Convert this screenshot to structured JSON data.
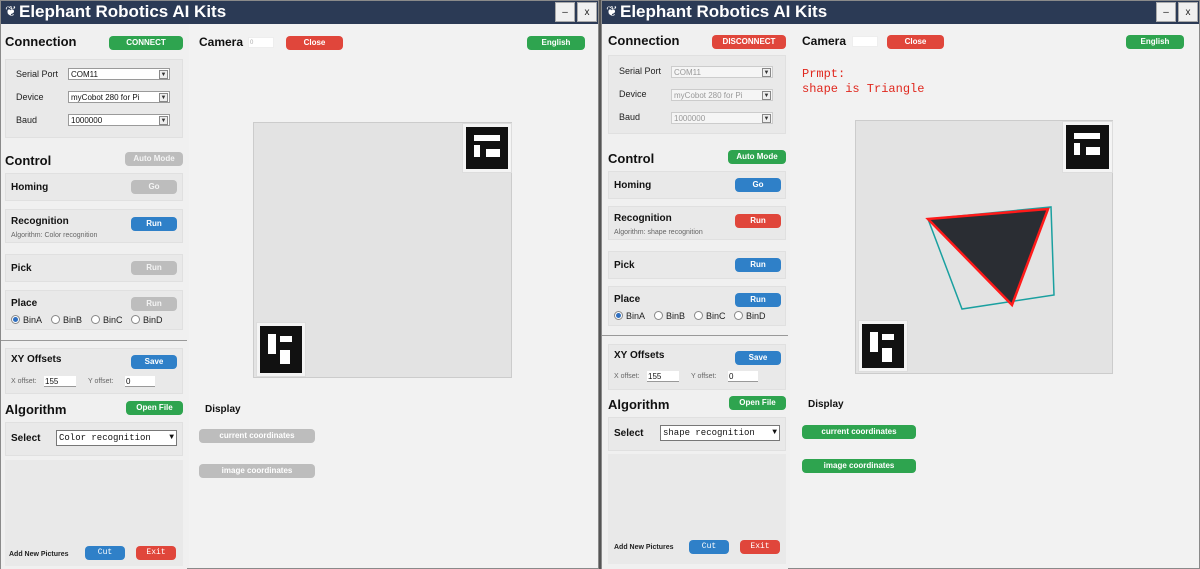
{
  "app_title": "Elephant Robotics AI Kits",
  "window_controls": {
    "minimize": "–",
    "close": "x"
  },
  "left_window": {
    "connection": {
      "title": "Connection",
      "button": "CONNECT",
      "serial_port_label": "Serial Port",
      "serial_port_value": "COM11",
      "device_label": "Device",
      "device_value": "myCobot 280 for Pi",
      "baud_label": "Baud",
      "baud_value": "1000000"
    },
    "control": {
      "title": "Control",
      "auto_mode": "Auto Mode",
      "homing": "Homing",
      "go": "Go",
      "recognition": "Recognition",
      "run": "Run",
      "algorithm_note": "Algorithm: Color recognition",
      "pick": "Pick",
      "place": "Place",
      "bins": [
        "BinA",
        "BinB",
        "BinC",
        "BinD"
      ]
    },
    "offsets": {
      "title": "XY Offsets",
      "save": "Save",
      "x_label": "X offset:",
      "x_value": "155",
      "y_label": "Y offset:",
      "y_value": "0"
    },
    "algorithm": {
      "title": "Algorithm",
      "open_file": "Open File",
      "select_label": "Select",
      "select_value": "Color recognition"
    },
    "pictures": {
      "add_label": "Add New Pictures",
      "cut": "Cut",
      "exit": "Exit"
    },
    "camera": {
      "title": "Camera",
      "value": "0",
      "close": "Close",
      "language": "English"
    },
    "display": {
      "title": "Display",
      "current_coordinates": "current coordinates",
      "image_coordinates": "image coordinates"
    }
  },
  "right_window": {
    "connection": {
      "title": "Connection",
      "button": "DISCONNECT",
      "serial_port_label": "Serial Port",
      "serial_port_value": "COM11",
      "device_label": "Device",
      "device_value": "myCobot 280 for Pi",
      "baud_label": "Baud",
      "baud_value": "1000000"
    },
    "control": {
      "title": "Control",
      "auto_mode": "Auto Mode",
      "homing": "Homing",
      "go": "Go",
      "recognition": "Recognition",
      "run": "Run",
      "algorithm_note": "Algorithm: shape recognition",
      "pick": "Pick",
      "place": "Place",
      "bins": [
        "BinA",
        "BinB",
        "BinC",
        "BinD"
      ]
    },
    "offsets": {
      "title": "XY Offsets",
      "save": "Save",
      "x_label": "X offset:",
      "x_value": "155",
      "y_label": "Y offset:",
      "y_value": "0"
    },
    "algorithm": {
      "title": "Algorithm",
      "open_file": "Open File",
      "select_label": "Select",
      "select_value": "shape recognition"
    },
    "pictures": {
      "add_label": "Add New Pictures",
      "cut": "Cut",
      "exit": "Exit"
    },
    "camera": {
      "title": "Camera",
      "value": "",
      "close": "Close",
      "language": "English",
      "prompt_line1": "Prmpt:",
      "prompt_line2": "shape is Triangle"
    },
    "display": {
      "title": "Display",
      "current_coordinates": "current coordinates",
      "image_coordinates": "image coordinates"
    }
  },
  "colors": {
    "titlebar": "#2b3a55",
    "green": "#2ea44f",
    "red": "#e0463b",
    "blue": "#2f80c8",
    "disabled": "#bdbdbd",
    "prompt": "#e0281e",
    "detection_outline": "#ff0000",
    "bounding_box": "#1aa0a0"
  },
  "icons": {
    "title_icon": "elephant-icon"
  }
}
